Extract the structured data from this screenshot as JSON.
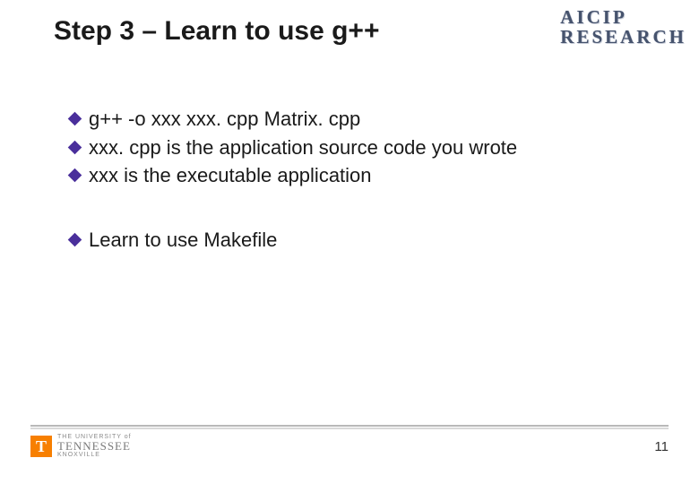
{
  "header": {
    "title": "Step 3 – Learn to use g++",
    "research_logo_line1": "AICIP",
    "research_logo_line2": "RESEARCH"
  },
  "bullets": {
    "b0": "g++ -o xxx xxx. cpp Matrix. cpp",
    "b1": "xxx. cpp is the application source code you wrote",
    "b2": "xxx is the executable application",
    "b3": "Learn to use Makefile"
  },
  "footer": {
    "ut_top": "THE UNIVERSITY of",
    "ut_mid": "TENNESSEE",
    "ut_bot": "KNOXVILLE",
    "ut_t": "T",
    "page": "11"
  }
}
